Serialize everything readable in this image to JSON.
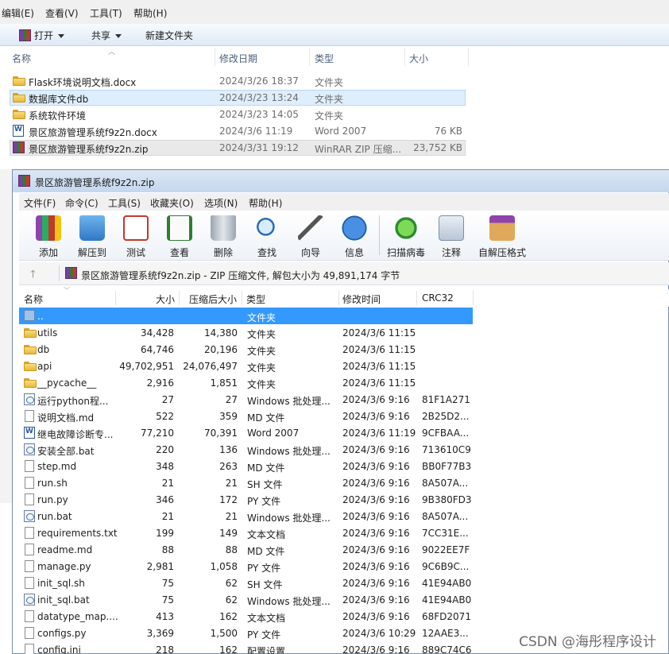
{
  "explorer": {
    "menu": [
      "编辑(E)",
      "查看(V)",
      "工具(T)",
      "帮助(H)"
    ],
    "toolbar": {
      "open": "打开",
      "share": "共享",
      "new_folder": "新建文件夹"
    },
    "columns": {
      "name": "名称",
      "modified": "修改日期",
      "type": "类型",
      "size": "大小"
    },
    "rows": [
      {
        "name": "Flask环境说明文档.docx",
        "modified": "2024/3/26 18:37",
        "type": "文件夹",
        "size": "",
        "icon": "folder-icon"
      },
      {
        "name": "数据库文件db",
        "modified": "2024/3/23 13:24",
        "type": "文件夹",
        "size": "",
        "icon": "folder-icon"
      },
      {
        "name": "系统软件环境",
        "modified": "2024/3/23 14:05",
        "type": "文件夹",
        "size": "",
        "icon": "folder-icon"
      },
      {
        "name": "景区旅游管理系统f9z2n.docx",
        "modified": "2024/3/6 11:19",
        "type": "Word 2007",
        "size": "76 KB",
        "icon": "word-document-icon"
      },
      {
        "name": "景区旅游管理系统f9z2n.zip",
        "modified": "2024/3/31 19:12",
        "type": "WinRAR ZIP 压缩...",
        "size": "23,752 KB",
        "icon": "winrar-archive-icon"
      }
    ]
  },
  "winrar": {
    "title": "景区旅游管理系统f9z2n.zip",
    "menu": [
      "文件(F)",
      "命令(C)",
      "工具(S)",
      "收藏夹(O)",
      "选项(N)",
      "帮助(H)"
    ],
    "toolbar": [
      "添加",
      "解压到",
      "测试",
      "查看",
      "删除",
      "查找",
      "向导",
      "信息",
      "扫描病毒",
      "注释",
      "自解压格式"
    ],
    "address": "景区旅游管理系统f9z2n.zip - ZIP 压缩文件, 解包大小为 49,891,174 字节",
    "columns": {
      "name": "名称",
      "size": "大小",
      "packed": "压缩后大小",
      "type": "类型",
      "modified": "修改时间",
      "crc": "CRC32"
    },
    "rows": [
      {
        "name": "..",
        "size": "",
        "packed": "",
        "type": "文件夹",
        "modified": "",
        "crc": ""
      },
      {
        "name": "utils",
        "size": "34,428",
        "packed": "14,380",
        "type": "文件夹",
        "modified": "2024/3/6 11:15",
        "crc": ""
      },
      {
        "name": "db",
        "size": "64,746",
        "packed": "20,196",
        "type": "文件夹",
        "modified": "2024/3/6 11:15",
        "crc": ""
      },
      {
        "name": "api",
        "size": "49,702,951",
        "packed": "24,076,497",
        "type": "文件夹",
        "modified": "2024/3/6 11:15",
        "crc": ""
      },
      {
        "name": "__pycache__",
        "size": "2,916",
        "packed": "1,851",
        "type": "文件夹",
        "modified": "2024/3/6 11:15",
        "crc": ""
      },
      {
        "name": "运行python程...",
        "size": "27",
        "packed": "27",
        "type": "Windows 批处理...",
        "modified": "2024/3/6 9:16",
        "crc": "81F1A271"
      },
      {
        "name": "说明文档.md",
        "size": "522",
        "packed": "359",
        "type": "MD 文件",
        "modified": "2024/3/6 9:16",
        "crc": "2B25D2..."
      },
      {
        "name": "继电故障诊断专...",
        "size": "77,210",
        "packed": "70,391",
        "type": "Word 2007",
        "modified": "2024/3/6 11:19",
        "crc": "9CFBAA..."
      },
      {
        "name": "安装全部.bat",
        "size": "220",
        "packed": "136",
        "type": "Windows 批处理...",
        "modified": "2024/3/6 9:16",
        "crc": "713610C9"
      },
      {
        "name": "step.md",
        "size": "348",
        "packed": "263",
        "type": "MD 文件",
        "modified": "2024/3/6 9:16",
        "crc": "BB0F77B3"
      },
      {
        "name": "run.sh",
        "size": "21",
        "packed": "21",
        "type": "SH 文件",
        "modified": "2024/3/6 9:16",
        "crc": "8A507A..."
      },
      {
        "name": "run.py",
        "size": "346",
        "packed": "172",
        "type": "PY 文件",
        "modified": "2024/3/6 9:16",
        "crc": "9B380FD3"
      },
      {
        "name": "run.bat",
        "size": "21",
        "packed": "21",
        "type": "Windows 批处理...",
        "modified": "2024/3/6 9:16",
        "crc": "8A507A..."
      },
      {
        "name": "requirements.txt",
        "size": "199",
        "packed": "149",
        "type": "文本文档",
        "modified": "2024/3/6 9:16",
        "crc": "7CC31E..."
      },
      {
        "name": "readme.md",
        "size": "88",
        "packed": "88",
        "type": "MD 文件",
        "modified": "2024/3/6 9:16",
        "crc": "9022EE7F"
      },
      {
        "name": "manage.py",
        "size": "2,981",
        "packed": "1,058",
        "type": "PY 文件",
        "modified": "2024/3/6 9:16",
        "crc": "9C6B9C..."
      },
      {
        "name": "init_sql.sh",
        "size": "75",
        "packed": "62",
        "type": "SH 文件",
        "modified": "2024/3/6 9:16",
        "crc": "41E94AB0"
      },
      {
        "name": "init_sql.bat",
        "size": "75",
        "packed": "62",
        "type": "Windows 批处理...",
        "modified": "2024/3/6 9:16",
        "crc": "41E94AB0"
      },
      {
        "name": "datatype_map....",
        "size": "413",
        "packed": "162",
        "type": "文本文档",
        "modified": "2024/3/6 9:16",
        "crc": "68FD2071"
      },
      {
        "name": "configs.py",
        "size": "3,369",
        "packed": "1,500",
        "type": "PY 文件",
        "modified": "2024/3/6 10:29",
        "crc": "12AAE3..."
      },
      {
        "name": "config.ini",
        "size": "218",
        "packed": "162",
        "type": "配置设置",
        "modified": "2024/3/6 9:16",
        "crc": "889C74C6"
      }
    ]
  },
  "watermark": "CSDN @海彤程序设计"
}
